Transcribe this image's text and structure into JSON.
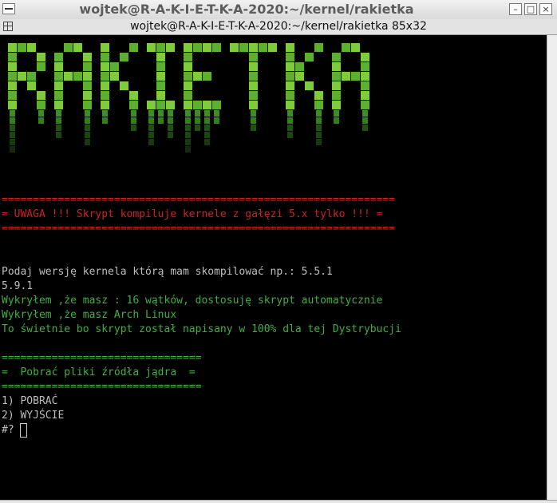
{
  "window": {
    "title": "wojtek@R-A-K-I-E-T-K-A-2020:~/kernel/rakietka",
    "subtitle": "wojtek@R-A-K-I-E-T-K-A-2020:~/kernel/rakietka 85x32",
    "minimize_label": "–",
    "maximize_label": "□",
    "close_label": "×"
  },
  "logo": {
    "text": "RAKIETKA",
    "colors": [
      "#2d6b1e",
      "#3c8f24",
      "#5bb02f",
      "#7ecc3c"
    ]
  },
  "terminal": {
    "banner": [
      "===============================================================",
      "= UWAGA !!! Skrypt kompiluje kernele z gałęzi 5.x tylko !!! =",
      "==============================================================="
    ],
    "prompt_version": "Podaj wersję kernela którą mam skompilować np.: 5.5.1",
    "entered_version": "5.9.1",
    "info_lines": [
      "Wykryłem ,że masz : 16 wątków, dostosuję skrypt automatycznie",
      "Wykryłem ,że masz Arch Linux",
      "To świetnie bo skrypt został napisany w 100% dla tej Dystrybucji"
    ],
    "menu_header": [
      "================================",
      "=  Pobrać pliki źródła jądra  =",
      "================================"
    ],
    "options": [
      "1) POBRAĆ",
      "2) WYJŚCIE"
    ],
    "select_prompt": "#?"
  },
  "colors": {
    "red": "#cc2222",
    "green": "#3fb03f",
    "gray": "#bdbdbd",
    "background": "#000000"
  }
}
